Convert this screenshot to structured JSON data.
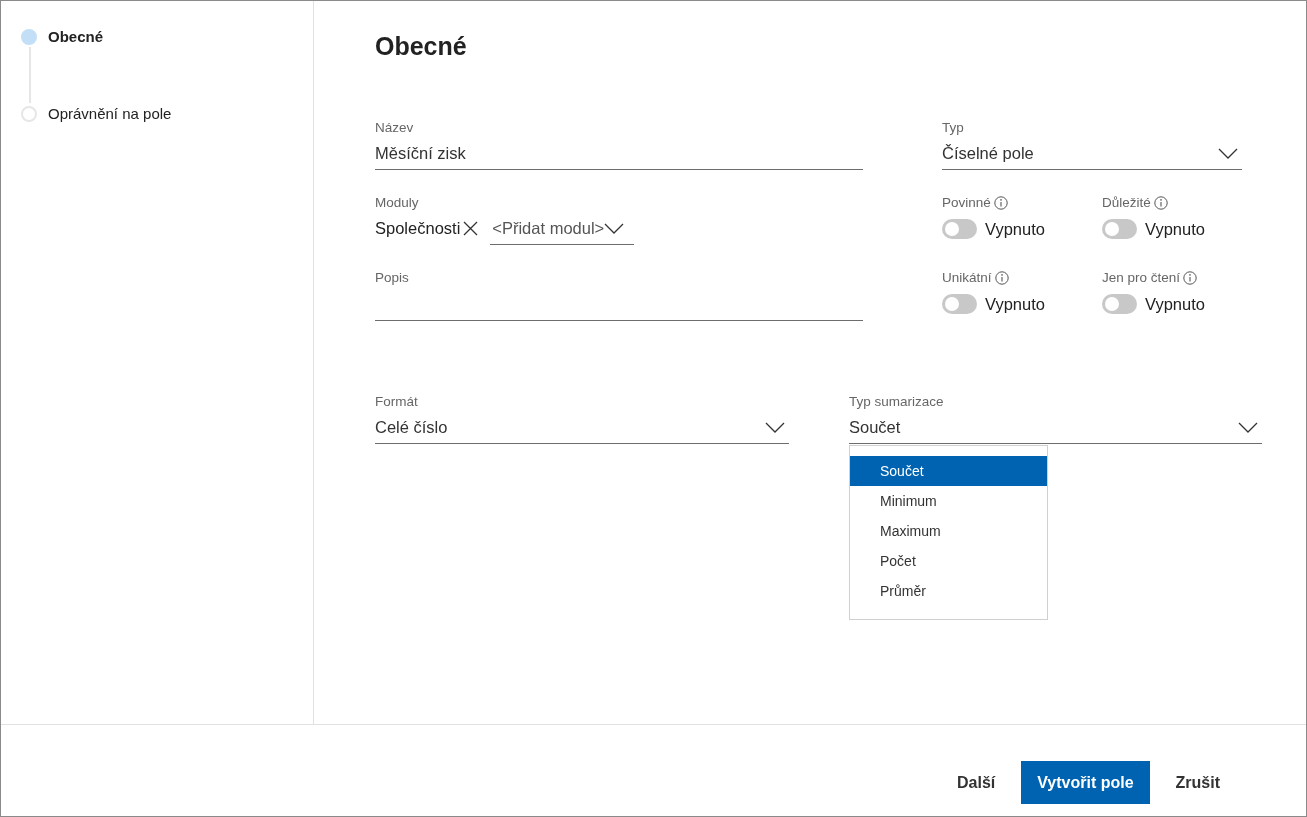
{
  "steps": [
    {
      "label": "Obecné",
      "selected": true
    },
    {
      "label": "Oprávnění na pole",
      "selected": false
    }
  ],
  "heading": "Obecné",
  "name_field": {
    "label": "Název",
    "value": "Měsíční zisk"
  },
  "modules_field": {
    "label": "Moduly",
    "tags": [
      "Společnosti"
    ],
    "add_placeholder": "<Přidat modul>"
  },
  "description_field": {
    "label": "Popis"
  },
  "type_field": {
    "label": "Typ",
    "value": "Číselné pole"
  },
  "toggles": [
    {
      "label": "Povinné",
      "on": false,
      "state_text": "Vypnuto"
    },
    {
      "label": "Důležité",
      "on": false,
      "state_text": "Vypnuto"
    },
    {
      "label": "Unikátní",
      "on": false,
      "state_text": "Vypnuto"
    },
    {
      "label": "Jen pro čtení",
      "on": false,
      "state_text": "Vypnuto"
    }
  ],
  "format_field": {
    "label": "Formát",
    "value": "Celé číslo"
  },
  "summary_field": {
    "label": "Typ sumarizace",
    "value": "Součet",
    "expanded": true,
    "options": [
      {
        "label": "Součet",
        "selected": true
      },
      {
        "label": "Minimum",
        "selected": false
      },
      {
        "label": "Maximum",
        "selected": false
      },
      {
        "label": "Počet",
        "selected": false
      },
      {
        "label": "Průměr",
        "selected": false
      }
    ]
  },
  "buttons": [
    {
      "label": "Další",
      "kind": "text"
    },
    {
      "label": "Vytvořit pole",
      "kind": "primary"
    },
    {
      "label": "Zrušit",
      "kind": "text"
    }
  ]
}
